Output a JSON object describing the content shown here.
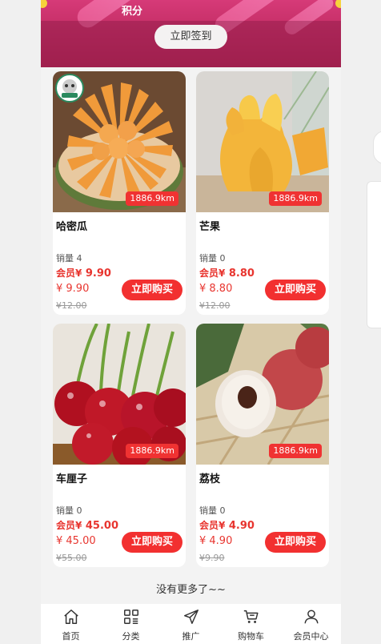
{
  "banner": {
    "points_label": "积分",
    "sign_in_label": "立即签到"
  },
  "products": [
    {
      "name": "哈密瓜",
      "distance": "1886.9km",
      "sales": "销量 4",
      "member_label": "会员¥",
      "member_price": "9.90",
      "price": "¥ 9.90",
      "original_price": "¥12.00",
      "buy_label": "立即购买"
    },
    {
      "name": "芒果",
      "distance": "1886.9km",
      "sales": "销量 0",
      "member_label": "会员¥",
      "member_price": "8.80",
      "price": "¥ 8.80",
      "original_price": "¥12.00",
      "buy_label": "立即购买"
    },
    {
      "name": "车厘子",
      "distance": "1886.9km",
      "sales": "销量 0",
      "member_label": "会员¥",
      "member_price": "45.00",
      "price": "¥ 45.00",
      "original_price": "¥55.00",
      "buy_label": "立即购买"
    },
    {
      "name": "荔枝",
      "distance": "1886.9km",
      "sales": "销量 0",
      "member_label": "会员¥",
      "member_price": "4.90",
      "price": "¥ 4.90",
      "original_price": "¥9.90",
      "buy_label": "立即购买"
    }
  ],
  "no_more_text": "没有更多了~~",
  "tabbar": {
    "items": [
      {
        "label": "首页",
        "icon": "home-icon"
      },
      {
        "label": "分类",
        "icon": "category-icon"
      },
      {
        "label": "推广",
        "icon": "send-icon"
      },
      {
        "label": "购物车",
        "icon": "cart-icon"
      },
      {
        "label": "会员中心",
        "icon": "user-icon"
      }
    ]
  },
  "colors": {
    "accent": "#f23030",
    "banner": "#c62f67",
    "price": "#e8352f"
  }
}
